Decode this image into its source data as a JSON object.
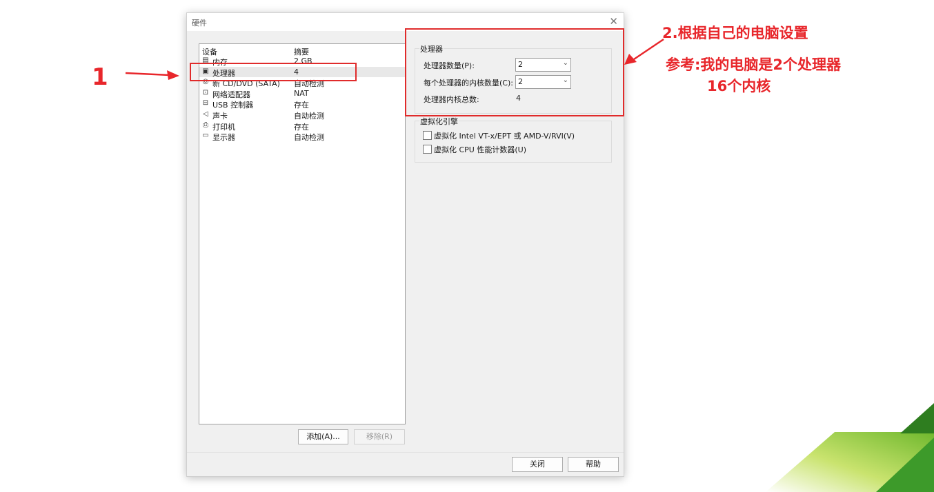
{
  "dialog": {
    "title": "硬件",
    "close_icon": "✕",
    "list": {
      "header_device": "设备",
      "header_summary": "摘要",
      "rows": [
        {
          "icon": "memory-icon",
          "glyph": "▤",
          "name": "内存",
          "summary": "2 GB"
        },
        {
          "icon": "processor-icon",
          "glyph": "▣",
          "name": "处理器",
          "summary": "4"
        },
        {
          "icon": "cd-dvd-icon",
          "glyph": "◎",
          "name": "新 CD/DVD (SATA)",
          "summary": "自动检测"
        },
        {
          "icon": "network-adapter-icon",
          "glyph": "⊡",
          "name": "网络适配器",
          "summary": "NAT"
        },
        {
          "icon": "usb-icon",
          "glyph": "⊟",
          "name": "USB 控制器",
          "summary": "存在"
        },
        {
          "icon": "sound-card-icon",
          "glyph": "◁",
          "name": "声卡",
          "summary": "自动检测"
        },
        {
          "icon": "printer-icon",
          "glyph": "⎙",
          "name": "打印机",
          "summary": "存在"
        },
        {
          "icon": "display-icon",
          "glyph": "▭",
          "name": "显示器",
          "summary": "自动检测"
        }
      ],
      "selected_index": 1
    },
    "add_button": "添加(A)...",
    "remove_button": "移除(R)",
    "processor_group": {
      "label": "处理器",
      "count_label": "处理器数量(P):",
      "count_value": "2",
      "cores_label": "每个处理器的内核数量(C):",
      "cores_value": "2",
      "total_label": "处理器内核总数:",
      "total_value": "4"
    },
    "virtualization_group": {
      "label": "虚拟化引擎",
      "option1": "虚拟化 Intel VT-x/EPT 或 AMD-V/RVI(V)",
      "option1_checked": false,
      "option2": "虚拟化 CPU 性能计数器(U)",
      "option2_checked": false
    },
    "close_button": "关闭",
    "help_button": "帮助"
  },
  "annotations": {
    "step1": "1",
    "step2_line1": "2.根据自己的电脑设置",
    "step2_line2": "参考:我的电脑是2个处理器",
    "step2_line3": "16个内核",
    "color": "#e8262b"
  }
}
